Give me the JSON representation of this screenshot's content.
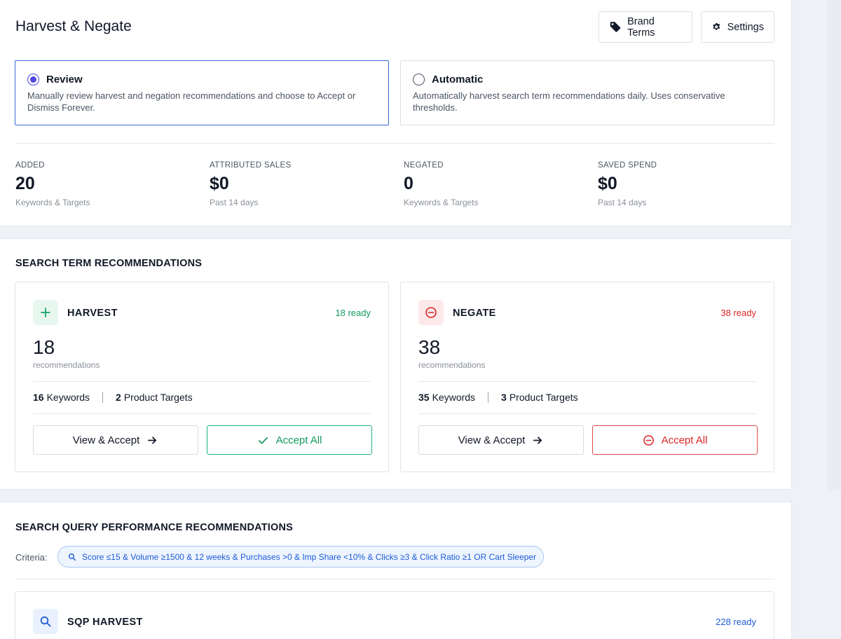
{
  "header": {
    "title": "Harvest & Negate",
    "brand_terms_label": "Brand Terms",
    "settings_label": "Settings"
  },
  "modes": {
    "review": {
      "title": "Review",
      "description": "Manually review harvest and negation recommendations and choose to Accept or Dismiss Forever.",
      "selected": true
    },
    "automatic": {
      "title": "Automatic",
      "description": "Automatically harvest search term recommendations daily. Uses conservative thresholds.",
      "selected": false
    }
  },
  "stats": [
    {
      "label": "ADDED",
      "value": "20",
      "sub": "Keywords & Targets"
    },
    {
      "label": "ATTRIBUTED SALES",
      "value": "$0",
      "sub": "Past 14 days"
    },
    {
      "label": "NEGATED",
      "value": "0",
      "sub": "Keywords & Targets"
    },
    {
      "label": "SAVED SPEND",
      "value": "$0",
      "sub": "Past 14 days"
    }
  ],
  "search_term": {
    "section_title": "SEARCH TERM RECOMMENDATIONS",
    "harvest": {
      "title": "HARVEST",
      "ready": "18 ready",
      "count": "18",
      "count_label": "recommendations",
      "keywords_count": "16",
      "keywords_label": "Keywords",
      "targets_count": "2",
      "targets_label": "Product Targets",
      "view_label": "View & Accept",
      "accept_label": "Accept All"
    },
    "negate": {
      "title": "NEGATE",
      "ready": "38 ready",
      "count": "38",
      "count_label": "recommendations",
      "keywords_count": "35",
      "keywords_label": "Keywords",
      "targets_count": "3",
      "targets_label": "Product Targets",
      "view_label": "View & Accept",
      "accept_label": "Accept All"
    }
  },
  "sqp": {
    "section_title": "SEARCH QUERY PERFORMANCE RECOMMENDATIONS",
    "criteria_label": "Criteria:",
    "criteria_text": "Score ≤15 & Volume ≥1500 & 12 weeks & Purchases >0 & Imp Share <10% & Clicks ≥3 & Click Ratio ≥1 OR Cart Sleeper",
    "harvest_title": "SQP HARVEST",
    "harvest_ready": "228 ready"
  },
  "colors": {
    "accent": "#3867d6",
    "green": "#15995f",
    "red": "#dc2626",
    "blue": "#1d5bd6"
  },
  "icons": [
    "tag-icon",
    "gear-icon",
    "plus-icon",
    "minus-circle-icon",
    "arrow-right-icon",
    "check-icon",
    "search-icon"
  ]
}
